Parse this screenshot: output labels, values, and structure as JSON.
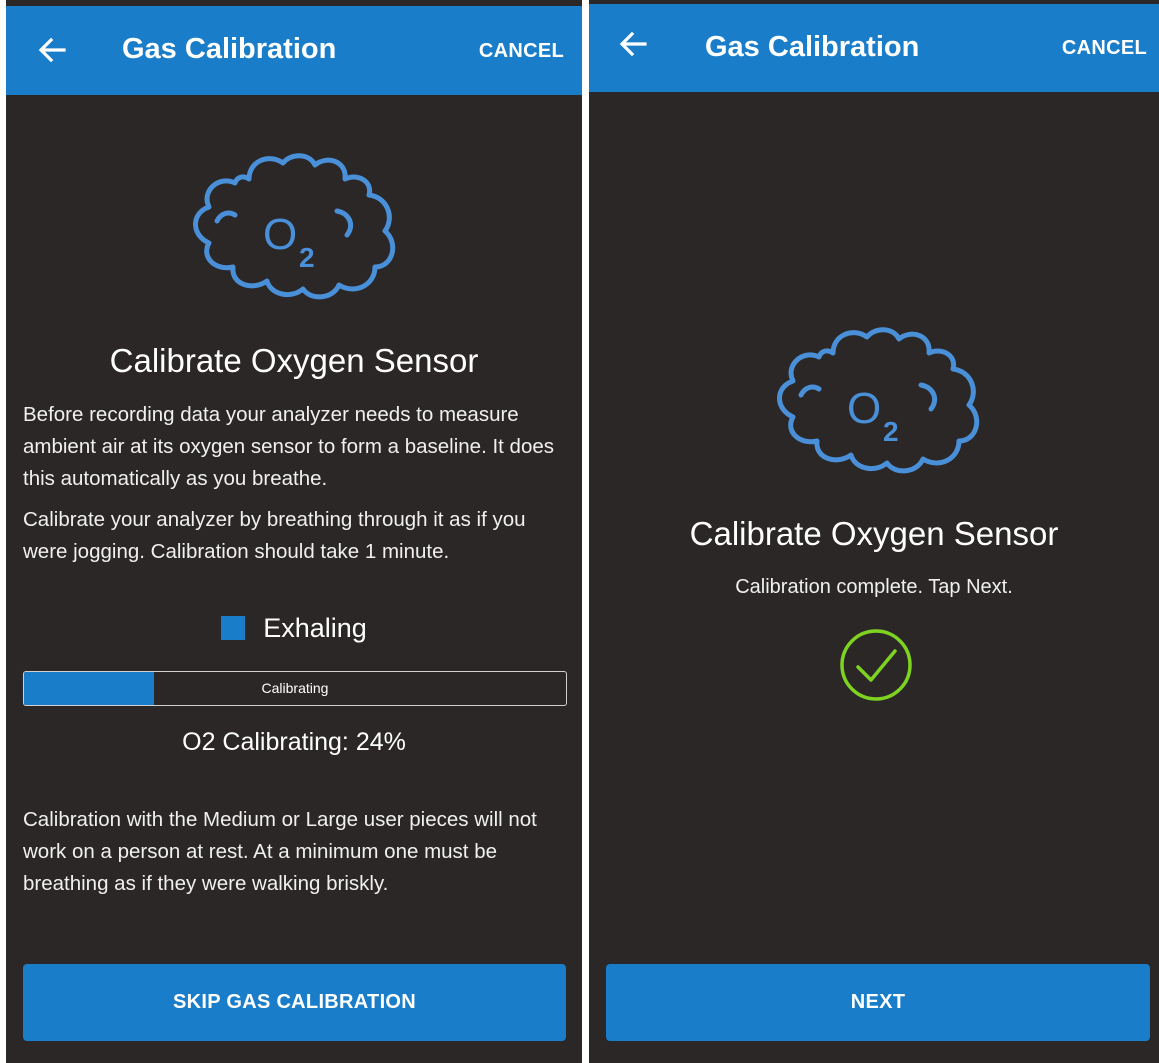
{
  "colors": {
    "appbar": "#1a7dc9",
    "background": "#2a2726",
    "accent": "#1a7dc9",
    "success": "#7ed321"
  },
  "left_screen": {
    "header": {
      "back_icon": "arrow-left-icon",
      "title": "Gas Calibration",
      "cancel_label": "CANCEL"
    },
    "illustration_icon": "o2-cloud-icon",
    "illustration_text": {
      "o": "O",
      "sub": "2"
    },
    "heading": "Calibrate Oxygen Sensor",
    "paragraph_1": "Before recording data your analyzer needs to measure ambient air at its oxygen sensor to form a baseline. It does this automatically as you breathe.",
    "paragraph_2": "Calibrate your analyzer by breathing through it as if you were jogging. Calibration should take 1 minute.",
    "status": {
      "icon": "blue-square-icon",
      "label": "Exhaling"
    },
    "progress": {
      "label": "Calibrating",
      "value": 0.24
    },
    "percent_text": "O2 Calibrating: 24%",
    "note": "Calibration  with the Medium or Large user pieces will not work on a person at rest. At a minimum one must be breathing as if they were walking briskly.",
    "button_label": "SKIP GAS CALIBRATION"
  },
  "right_screen": {
    "header": {
      "back_icon": "arrow-left-icon",
      "title": "Gas Calibration",
      "cancel_label": "CANCEL"
    },
    "illustration_icon": "o2-cloud-icon",
    "illustration_text": {
      "o": "O",
      "sub": "2"
    },
    "heading": "Calibrate Oxygen Sensor",
    "subtext": "Calibration complete. Tap Next.",
    "status_icon": "check-circle-icon",
    "button_label": "NEXT"
  }
}
